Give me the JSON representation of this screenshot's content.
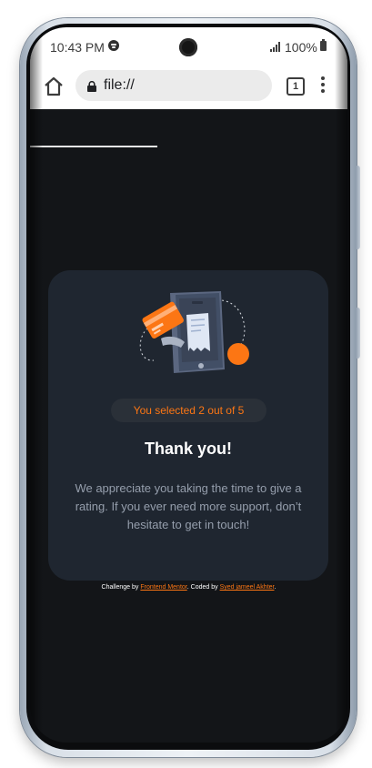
{
  "status_bar": {
    "time": "10:43 PM",
    "battery": "100%",
    "icons": [
      "spotify-icon",
      "camera-icon",
      "signal-icon",
      "battery-icon"
    ]
  },
  "browser": {
    "url": "file://",
    "tab_count": "1",
    "icons": [
      "home-icon",
      "lock-icon",
      "more-vert-icon"
    ]
  },
  "card": {
    "illustration": "phone-payment-illustration",
    "selection_text": "You selected 2 out of 5",
    "rating_selected": 2,
    "rating_max": 5,
    "title": "Thank you!",
    "message": "We appreciate you taking the time to give a rating. If you ever need more support, don’t hesitate to get in touch!"
  },
  "attribution": {
    "prefix": "Challenge by",
    "link1": "Frontend Mentor",
    "middle": ". Coded by",
    "link2": "Syed jameel Akhter",
    "suffix": "."
  },
  "colors": {
    "accent": "#fc7614",
    "background": "#131518",
    "card": "#1f2630",
    "muted_text": "#959eac"
  }
}
